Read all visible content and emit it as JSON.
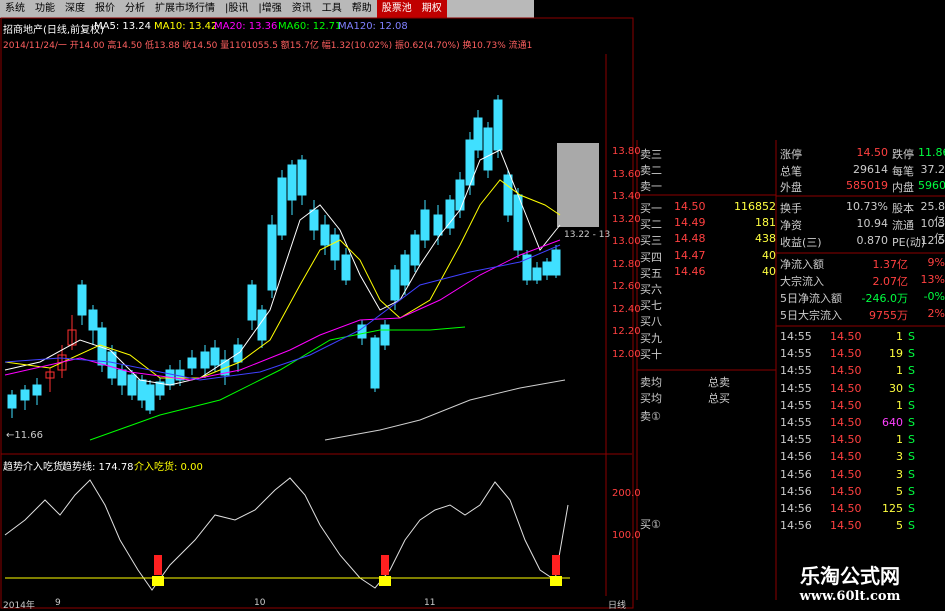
{
  "menu": [
    "系统",
    "功能",
    "报价",
    "分析",
    "扩展市场行情",
    "资讯",
    "工具",
    "帮助",
    "股票池",
    "期权"
  ],
  "menu_pre": [
    "系统",
    "功能",
    "深度",
    "报价",
    "分析",
    "扩展市场行情",
    "|股讯",
    "|增强",
    "资讯",
    "工具",
    "帮助",
    "股票池",
    "期权"
  ],
  "stock_header": {
    "name": "招商地产(日线,前复权)",
    "ma5": "MA5: 13.24",
    "ma10": "MA10: 13.42",
    "ma20": "MA20: 13.36",
    "ma60": "MA60: 12.71",
    "ma120": "MA120: 12.08"
  },
  "info_line": "2014/11/24/一 开14.00 高14.50 低13.88 收14.50 量1101055.5 额15.7亿 幅1.32(10.02%) 振0.62(4.70%) 换10.73% 流通10.3亿 全国",
  "price_axis": [
    "13.80",
    "13.60",
    "13.40",
    "13.20",
    "13.00",
    "12.80",
    "12.60",
    "12.40",
    "12.20",
    "12.00"
  ],
  "low_marker": "←11.66",
  "price_tag": "13.22 - 13",
  "indicator_header": {
    "name": "趋势介入吃货",
    "value": "趋势线: 174.78",
    "buy": "介入吃货: 0.00"
  },
  "indicator_axis": [
    "200.0",
    "100.0"
  ],
  "time_axis": [
    "2014年",
    "9",
    "10",
    "11",
    "日线"
  ],
  "orderbook": {
    "sell_labels": [
      "卖三",
      "卖二",
      "卖一"
    ],
    "buy": [
      {
        "label": "买一",
        "price": "14.50",
        "vol": "116852"
      },
      {
        "label": "买二",
        "price": "14.49",
        "vol": "181"
      },
      {
        "label": "买三",
        "price": "14.48",
        "vol": "438"
      },
      {
        "label": "买四",
        "price": "14.47",
        "vol": "40"
      },
      {
        "label": "买五",
        "price": "14.46",
        "vol": "40"
      },
      {
        "label": "买六",
        "price": "",
        "vol": ""
      },
      {
        "label": "买七",
        "price": "",
        "vol": ""
      },
      {
        "label": "买八",
        "price": "",
        "vol": ""
      },
      {
        "label": "买九",
        "price": "",
        "vol": ""
      },
      {
        "label": "买十",
        "price": "",
        "vol": ""
      }
    ],
    "total_sell_label": "卖均",
    "total_buy_label": "买均",
    "total_sell": "总卖",
    "total_buy": "总买",
    "sell1_marker": "卖①",
    "buy1_marker": "买①"
  },
  "quote": [
    {
      "l1": "涨停",
      "v1": "14.50",
      "l2": "跌停",
      "v2": "11.86"
    },
    {
      "l1": "总笔",
      "v1": "29614",
      "l2": "每笔",
      "v2": "37.2"
    },
    {
      "l1": "外盘",
      "v1": "585019",
      "l2": "内盘",
      "v2": "5960"
    },
    {
      "l1": "换手",
      "v1": "10.73%",
      "l2": "股本",
      "v2": "25.8亿"
    },
    {
      "l1": "净资",
      "v1": "10.94",
      "l2": "流通",
      "v2": "10.3亿"
    },
    {
      "l1": "收益(三)",
      "v1": "0.870",
      "l2": "PE(动)",
      "v2": "12.5"
    }
  ],
  "flows": [
    {
      "label": "净流入额",
      "value": "1.37亿",
      "pct": "9%"
    },
    {
      "label": "大宗流入",
      "value": "2.07亿",
      "pct": "13%"
    },
    {
      "label": "5日净流入额",
      "value": "-246.0万",
      "pct": "-0%"
    },
    {
      "label": "5日大宗流入",
      "value": "9755万",
      "pct": "2%"
    }
  ],
  "ticks": [
    {
      "time": "14:55",
      "price": "14.50",
      "vol": "1",
      "side": "S"
    },
    {
      "time": "14:55",
      "price": "14.50",
      "vol": "19",
      "side": "S"
    },
    {
      "time": "14:55",
      "price": "14.50",
      "vol": "1",
      "side": "S"
    },
    {
      "time": "14:55",
      "price": "14.50",
      "vol": "30",
      "side": "S"
    },
    {
      "time": "14:55",
      "price": "14.50",
      "vol": "1",
      "side": "S"
    },
    {
      "time": "14:55",
      "price": "14.50",
      "vol": "640",
      "side": "S"
    },
    {
      "time": "14:55",
      "price": "14.50",
      "vol": "1",
      "side": "S"
    },
    {
      "time": "14:56",
      "price": "14.50",
      "vol": "3",
      "side": "S"
    },
    {
      "time": "14:56",
      "price": "14.50",
      "vol": "3",
      "side": "S"
    },
    {
      "time": "14:56",
      "price": "14.50",
      "vol": "5",
      "side": "S"
    },
    {
      "time": "14:56",
      "price": "14.50",
      "vol": "125",
      "side": "S"
    },
    {
      "time": "14:56",
      "price": "14.50",
      "vol": "5",
      "side": "S"
    }
  ],
  "watermark": {
    "title": "乐淘公式网",
    "url": "www.60lt.com"
  },
  "colors": {
    "up": "#ff3030",
    "down": "#40e0ff",
    "ma5": "#ffffff",
    "ma10": "#ffff00",
    "ma20": "#ff00ff",
    "ma60": "#00ff00",
    "ma120": "#4040ff"
  }
}
